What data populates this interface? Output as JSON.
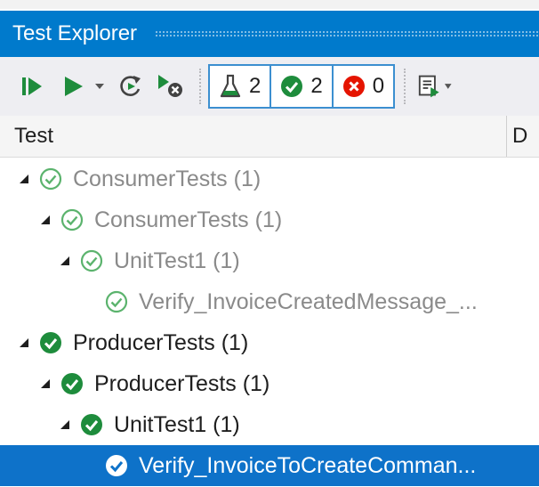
{
  "window": {
    "title": "Test Explorer"
  },
  "toolbar": {
    "run_all_icon": "run-all-icon",
    "run_icon": "run-icon",
    "repeat_icon": "repeat-last-run-icon",
    "cancel_icon": "cancel-run-icon",
    "counts": {
      "total": "2",
      "passed": "2",
      "failed": "0"
    },
    "playlist_icon": "playlist-icon"
  },
  "columns": {
    "test": "Test",
    "duration": "D"
  },
  "tree": [
    {
      "label": "ConsumerTests (1)",
      "level": 0,
      "state": "passed-old",
      "expanded": true
    },
    {
      "label": "ConsumerTests (1)",
      "level": 1,
      "state": "passed-old",
      "expanded": true
    },
    {
      "label": "UnitTest1 (1)",
      "level": 2,
      "state": "passed-old",
      "expanded": true
    },
    {
      "label": "Verify_InvoiceCreatedMessage_...",
      "level": 3,
      "state": "passed-old",
      "expanded": false
    },
    {
      "label": "ProducerTests (1)",
      "level": 0,
      "state": "passed",
      "expanded": true
    },
    {
      "label": "ProducerTests (1)",
      "level": 1,
      "state": "passed",
      "expanded": true
    },
    {
      "label": "UnitTest1 (1)",
      "level": 2,
      "state": "passed",
      "expanded": true
    },
    {
      "label": "Verify_InvoiceToCreateComman...",
      "level": 3,
      "state": "selected",
      "expanded": false
    }
  ],
  "colors": {
    "accent": "#007acc",
    "selected": "#0e72c9",
    "passed": "#1e8c3c",
    "passed_old": "#5bb36d",
    "failed": "#e51400"
  }
}
